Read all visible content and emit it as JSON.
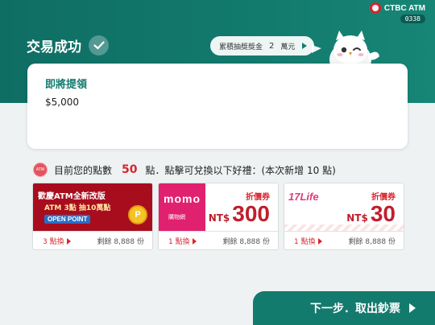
{
  "header": {
    "brand": "CTBC ATM",
    "machine_id": "0338",
    "title": "交易成功"
  },
  "prize_bubble": {
    "label": "累積抽獎獎金",
    "amount": "2",
    "unit": "萬元"
  },
  "withdrawal": {
    "label": "即將提領",
    "amount": "$5,000"
  },
  "points": {
    "badge_text": "ATM",
    "prefix": "目前您的點數",
    "value": "50",
    "suffix": "點．點擊可兌換以下好禮：(本次新增 10 點)"
  },
  "rewards": [
    {
      "banner_line1": "歡慶ATM全新改版",
      "banner_line2": "ATM 3點 抽10萬點",
      "banner_line3": "OPEN POINT",
      "coin": "P",
      "exchange": "3 點換",
      "remain": "剩餘 8,888 份"
    },
    {
      "logo": "momo",
      "logo_sub": "購物網",
      "coupon": "折價券",
      "currency": "NT$",
      "amount": "300",
      "exchange": "1 點換",
      "remain": "剩餘 8,888 份"
    },
    {
      "logo_a": "17",
      "logo_b": "Life",
      "coupon": "折價券",
      "currency": "NT$",
      "amount": "30",
      "exchange": "1 點換",
      "remain": "剩餘 8,888 份"
    }
  ],
  "next_button": {
    "label": "下一步．取出鈔票"
  },
  "colors": {
    "primary": "#137a6e",
    "accent": "#d6262e"
  }
}
